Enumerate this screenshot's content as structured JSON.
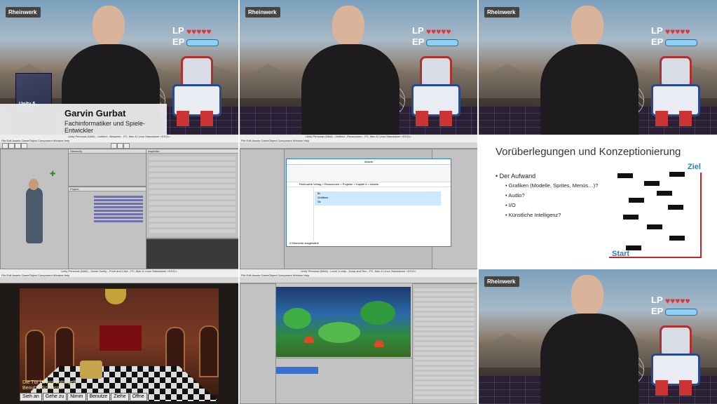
{
  "presenter": {
    "logo": "Rheinwerk",
    "lp_label": "LP",
    "ep_label": "EP",
    "hearts": "♥♥♥♥♥",
    "name": "Garvin Gurbat",
    "role": "Fachinformatiker und Spiele-Entwickler",
    "book_title": "Unity 5"
  },
  "slide": {
    "title": "Vorüberlegungen und Konzeptionierung",
    "bullet_main": "Der Aufwand",
    "bullets": [
      "Grafiken (Modelle, Sprites, Menüs…)?",
      "Audio?",
      "I/O",
      "Künstliche Intelligenz?"
    ],
    "goal_label": "Ziel",
    "start_label": "Start"
  },
  "unity_window_1": {
    "title": "Unity Personal (64bit) - Untitled - Beispiele - PC, Mac & Linux Standalone <DX11>",
    "menu": "File  Edit  Assets  GameObject  Component  Window  Help",
    "hierarchy": "Hierarchy",
    "scene": "Scene",
    "inspector": "Inspector",
    "project": "Project"
  },
  "unity_window_2": {
    "title": "Unity Personal (64bit) - Untitled - Ressourcen - PC, Mac & Linux Standalone <DX11>",
    "menu": "File  Edit  Assets  GameObject  Component  Window  Help",
    "explorer_title": "Assets",
    "path": "Rheinwerk Verlag > Ressourcen > Projekte > Kapitel 4 > Assets",
    "files": [
      "Bi",
      "Grafiken",
      "Sk"
    ],
    "status": "3 Elemente ausgewählt"
  },
  "unity_window_3": {
    "title": "Unity Personal (64bit) - Game Sunity - Point and Click - PC, Mac & Linux Standalone <DX11>",
    "menu": "File  Edit  Assets  GameObject  Component  Window  Help",
    "message_line1": "Die Tür ist nun entriegelt.",
    "message_line2": "Benutze Schlüssel",
    "verbs": [
      "Sieh an",
      "Gehe zu",
      "Nimm",
      "Benutze",
      "Ziehe",
      "Öffne"
    ]
  },
  "unity_window_4": {
    "title": "Unity Personal (64bit) - Level 1.unity - Jump and Run - PC, Mac & Linux Standalone <DX11>",
    "menu": "File  Edit  Assets  GameObject  Component  Window  Help"
  },
  "colors": {
    "heart": "#e0343c",
    "ep_bar": "#8fd1f3",
    "slide_label": "#2a7ec2",
    "slide_line": "#cc2222"
  }
}
